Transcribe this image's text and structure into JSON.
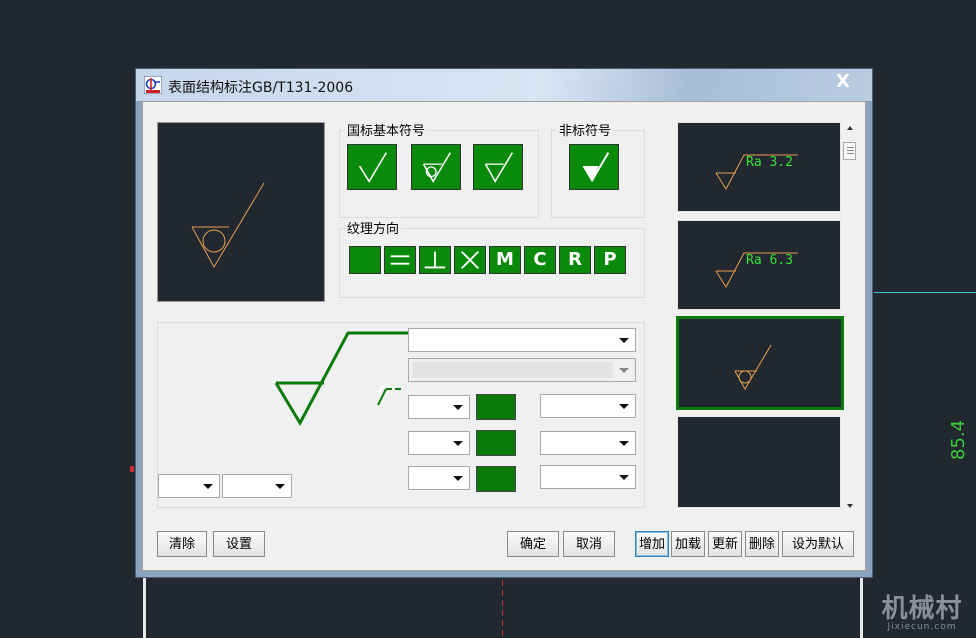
{
  "window": {
    "title": "表面结构标注GB/T131-2006",
    "close_label": "X"
  },
  "groups": {
    "basic_symbols_label": "国标基本符号",
    "nonstandard_symbols_label": "非标符号",
    "texture_direction_label": "纹理方向"
  },
  "texture_buttons": {
    "m": "M",
    "c": "C",
    "r": "R",
    "p": "P"
  },
  "buttons": {
    "clear": "清除",
    "settings": "设置",
    "ok": "确定",
    "cancel": "取消",
    "add": "增加",
    "load": "加载",
    "update": "更新",
    "delete": "删除",
    "set_default": "设为默认"
  },
  "presets": [
    {
      "ra_label": "Ra  3.2"
    },
    {
      "ra_label": "Ra  6.3"
    },
    {
      "ra_label": ""
    },
    {
      "ra_label": ""
    }
  ],
  "background": {
    "dimension_text": "85.4",
    "watermark_main": "机械村",
    "watermark_sub": "Jixiecun.com"
  },
  "colors": {
    "symbol_green": "#0a8a0a",
    "cad_background": "#212830",
    "preview_stroke": "#e8a050",
    "ra_text": "#38e038"
  }
}
